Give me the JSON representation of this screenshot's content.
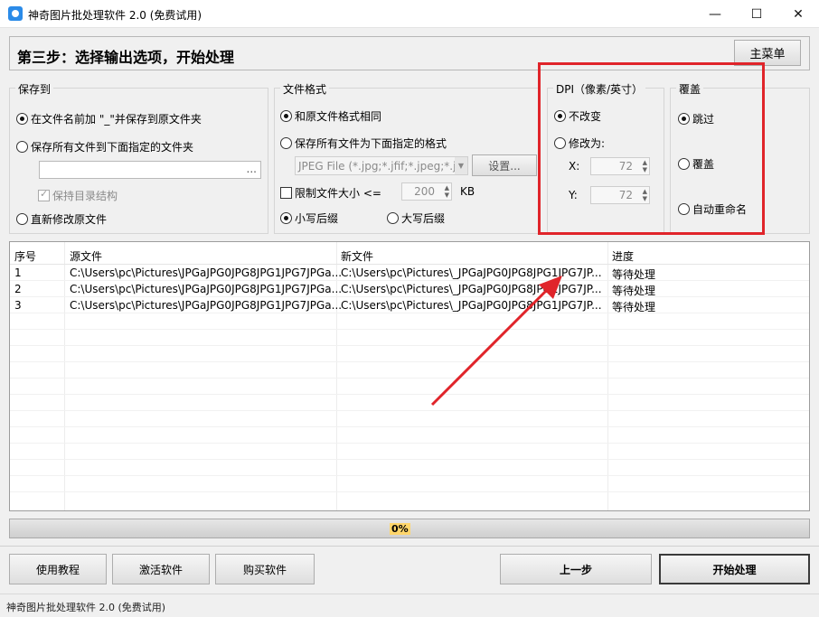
{
  "window": {
    "title": "神奇图片批处理软件 2.0 (免费试用)",
    "minimize": "—",
    "maximize": "☐",
    "close": "✕"
  },
  "step": {
    "title": "第三步：选择输出选项，开始处理",
    "main_menu": "主菜单"
  },
  "save_to": {
    "title": "保存到",
    "opt_prefix": "在文件名前加 \"_\"并保存到原文件夹",
    "opt_folder": "保存所有文件到下面指定的文件夹",
    "folder_value": "",
    "browse": "...",
    "keep_structure": "保持目录结构",
    "opt_overwrite": "直新修改原文件"
  },
  "file_format": {
    "title": "文件格式",
    "opt_same": "和原文件格式相同",
    "opt_specified": "保存所有文件为下面指定的格式",
    "format_value": "JPEG File (*.jpg;*.jfif;*.jpeg;*.j",
    "settings": "设置...",
    "limit_size": "限制文件大小 <=",
    "size_value": "200",
    "size_unit": "KB",
    "lowercase_ext": "小写后缀",
    "uppercase_ext": "大写后缀"
  },
  "dpi": {
    "title": "DPI（像素/英寸）",
    "opt_keep": "不改变",
    "opt_change": "修改为:",
    "x_label": "X:",
    "x_value": "72",
    "y_label": "Y:",
    "y_value": "72"
  },
  "overwrite": {
    "title": "覆盖",
    "opt_skip": "跳过",
    "opt_overwrite": "覆盖",
    "opt_rename": "自动重命名"
  },
  "table": {
    "columns": [
      "序号",
      "源文件",
      "新文件",
      "进度"
    ],
    "rows": [
      [
        "1",
        "C:\\Users\\pc\\Pictures\\JPGaJPG0JPG8JPG1JPG7JPGa...",
        "C:\\Users\\pc\\Pictures\\_JPGaJPG0JPG8JPG1JPG7JP...",
        "等待处理"
      ],
      [
        "2",
        "C:\\Users\\pc\\Pictures\\JPGaJPG0JPG8JPG1JPG7JPGa...",
        "C:\\Users\\pc\\Pictures\\_JPGaJPG0JPG8JPG1JPG7JP...",
        "等待处理"
      ],
      [
        "3",
        "C:\\Users\\pc\\Pictures\\JPGaJPG0JPG8JPG1JPG7JPGa...",
        "C:\\Users\\pc\\Pictures\\_JPGaJPG0JPG8JPG1JPG7JP...",
        "等待处理"
      ]
    ]
  },
  "progress": {
    "label": "0%",
    "value": 0
  },
  "buttons": {
    "tutorial": "使用教程",
    "activate": "激活软件",
    "buy": "购买软件",
    "prev": "上一步",
    "start": "开始处理"
  },
  "status": {
    "text": "神奇图片批处理软件 2.0 (免费试用)"
  },
  "colors": {
    "highlight": "#e0242a",
    "progress_label_bg": "#ffd66b"
  }
}
